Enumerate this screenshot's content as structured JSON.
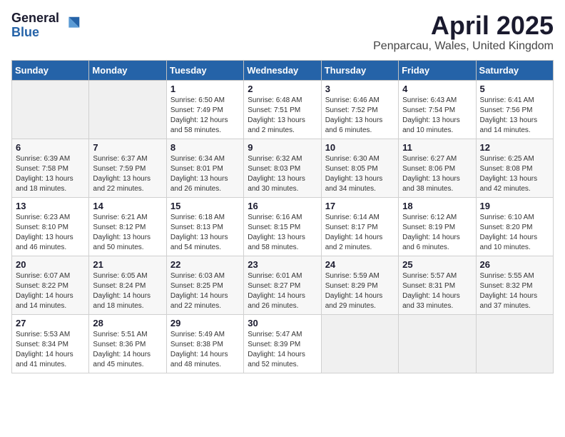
{
  "logo": {
    "general": "General",
    "blue": "Blue"
  },
  "title": "April 2025",
  "location": "Penparcau, Wales, United Kingdom",
  "days_of_week": [
    "Sunday",
    "Monday",
    "Tuesday",
    "Wednesday",
    "Thursday",
    "Friday",
    "Saturday"
  ],
  "weeks": [
    [
      {
        "num": "",
        "detail": ""
      },
      {
        "num": "",
        "detail": ""
      },
      {
        "num": "1",
        "detail": "Sunrise: 6:50 AM\nSunset: 7:49 PM\nDaylight: 12 hours\nand 58 minutes."
      },
      {
        "num": "2",
        "detail": "Sunrise: 6:48 AM\nSunset: 7:51 PM\nDaylight: 13 hours\nand 2 minutes."
      },
      {
        "num": "3",
        "detail": "Sunrise: 6:46 AM\nSunset: 7:52 PM\nDaylight: 13 hours\nand 6 minutes."
      },
      {
        "num": "4",
        "detail": "Sunrise: 6:43 AM\nSunset: 7:54 PM\nDaylight: 13 hours\nand 10 minutes."
      },
      {
        "num": "5",
        "detail": "Sunrise: 6:41 AM\nSunset: 7:56 PM\nDaylight: 13 hours\nand 14 minutes."
      }
    ],
    [
      {
        "num": "6",
        "detail": "Sunrise: 6:39 AM\nSunset: 7:58 PM\nDaylight: 13 hours\nand 18 minutes."
      },
      {
        "num": "7",
        "detail": "Sunrise: 6:37 AM\nSunset: 7:59 PM\nDaylight: 13 hours\nand 22 minutes."
      },
      {
        "num": "8",
        "detail": "Sunrise: 6:34 AM\nSunset: 8:01 PM\nDaylight: 13 hours\nand 26 minutes."
      },
      {
        "num": "9",
        "detail": "Sunrise: 6:32 AM\nSunset: 8:03 PM\nDaylight: 13 hours\nand 30 minutes."
      },
      {
        "num": "10",
        "detail": "Sunrise: 6:30 AM\nSunset: 8:05 PM\nDaylight: 13 hours\nand 34 minutes."
      },
      {
        "num": "11",
        "detail": "Sunrise: 6:27 AM\nSunset: 8:06 PM\nDaylight: 13 hours\nand 38 minutes."
      },
      {
        "num": "12",
        "detail": "Sunrise: 6:25 AM\nSunset: 8:08 PM\nDaylight: 13 hours\nand 42 minutes."
      }
    ],
    [
      {
        "num": "13",
        "detail": "Sunrise: 6:23 AM\nSunset: 8:10 PM\nDaylight: 13 hours\nand 46 minutes."
      },
      {
        "num": "14",
        "detail": "Sunrise: 6:21 AM\nSunset: 8:12 PM\nDaylight: 13 hours\nand 50 minutes."
      },
      {
        "num": "15",
        "detail": "Sunrise: 6:18 AM\nSunset: 8:13 PM\nDaylight: 13 hours\nand 54 minutes."
      },
      {
        "num": "16",
        "detail": "Sunrise: 6:16 AM\nSunset: 8:15 PM\nDaylight: 13 hours\nand 58 minutes."
      },
      {
        "num": "17",
        "detail": "Sunrise: 6:14 AM\nSunset: 8:17 PM\nDaylight: 14 hours\nand 2 minutes."
      },
      {
        "num": "18",
        "detail": "Sunrise: 6:12 AM\nSunset: 8:19 PM\nDaylight: 14 hours\nand 6 minutes."
      },
      {
        "num": "19",
        "detail": "Sunrise: 6:10 AM\nSunset: 8:20 PM\nDaylight: 14 hours\nand 10 minutes."
      }
    ],
    [
      {
        "num": "20",
        "detail": "Sunrise: 6:07 AM\nSunset: 8:22 PM\nDaylight: 14 hours\nand 14 minutes."
      },
      {
        "num": "21",
        "detail": "Sunrise: 6:05 AM\nSunset: 8:24 PM\nDaylight: 14 hours\nand 18 minutes."
      },
      {
        "num": "22",
        "detail": "Sunrise: 6:03 AM\nSunset: 8:25 PM\nDaylight: 14 hours\nand 22 minutes."
      },
      {
        "num": "23",
        "detail": "Sunrise: 6:01 AM\nSunset: 8:27 PM\nDaylight: 14 hours\nand 26 minutes."
      },
      {
        "num": "24",
        "detail": "Sunrise: 5:59 AM\nSunset: 8:29 PM\nDaylight: 14 hours\nand 29 minutes."
      },
      {
        "num": "25",
        "detail": "Sunrise: 5:57 AM\nSunset: 8:31 PM\nDaylight: 14 hours\nand 33 minutes."
      },
      {
        "num": "26",
        "detail": "Sunrise: 5:55 AM\nSunset: 8:32 PM\nDaylight: 14 hours\nand 37 minutes."
      }
    ],
    [
      {
        "num": "27",
        "detail": "Sunrise: 5:53 AM\nSunset: 8:34 PM\nDaylight: 14 hours\nand 41 minutes."
      },
      {
        "num": "28",
        "detail": "Sunrise: 5:51 AM\nSunset: 8:36 PM\nDaylight: 14 hours\nand 45 minutes."
      },
      {
        "num": "29",
        "detail": "Sunrise: 5:49 AM\nSunset: 8:38 PM\nDaylight: 14 hours\nand 48 minutes."
      },
      {
        "num": "30",
        "detail": "Sunrise: 5:47 AM\nSunset: 8:39 PM\nDaylight: 14 hours\nand 52 minutes."
      },
      {
        "num": "",
        "detail": ""
      },
      {
        "num": "",
        "detail": ""
      },
      {
        "num": "",
        "detail": ""
      }
    ]
  ]
}
